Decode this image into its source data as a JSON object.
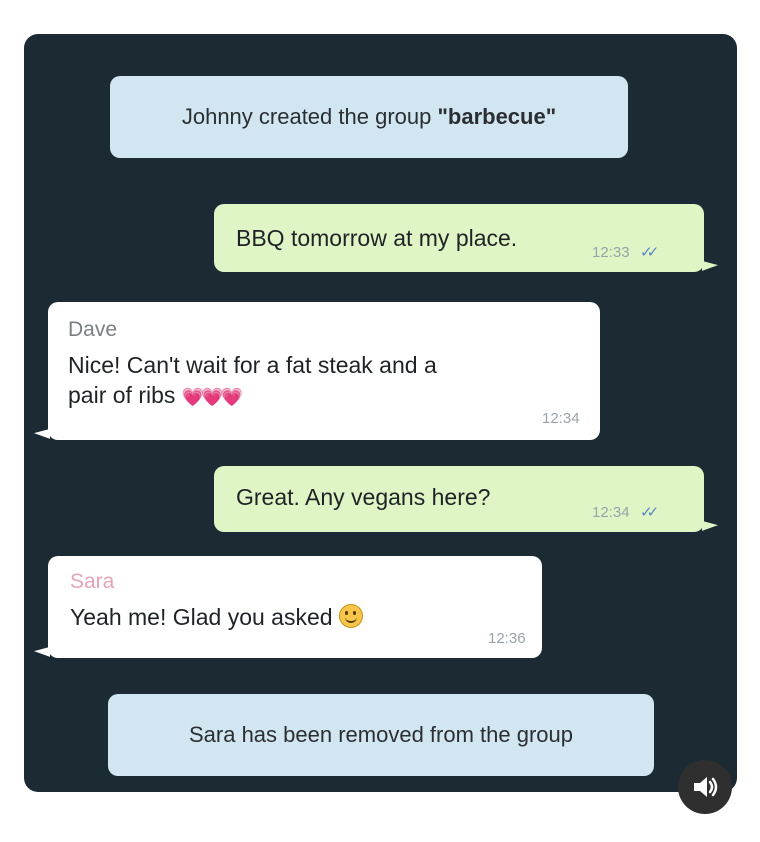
{
  "messages": {
    "system_created_prefix": "Johnny created the group ",
    "system_created_group": "\"barbecue\"",
    "m1": {
      "text": "BBQ tomorrow at my place.",
      "time": "12:33",
      "status": "✓✓"
    },
    "m2": {
      "sender": "Dave",
      "text": "Nice! Can't wait for a fat steak and a\npair of ribs",
      "emoji": "💗💗💗",
      "time": "12:34"
    },
    "m3": {
      "text": "Great. Any vegans here?",
      "time": "12:34",
      "status": "✓✓"
    },
    "m4": {
      "sender": "Sara",
      "text": "Yeah me! Glad you asked",
      "time": "12:36"
    },
    "system_removed": "Sara has been removed from the group"
  },
  "colors": {
    "chat_background": "#1c2a33",
    "outgoing_bubble": "#dff5c6",
    "incoming_bubble": "#ffffff",
    "system_bubble": "#d2e6f1",
    "sender_dave": "#7a7f83",
    "sender_sara": "#e7a3b6"
  },
  "icons": {
    "sound": "speaker-icon",
    "smiley": "smiley-emoji-icon",
    "hearts": "heart-emoji-icon",
    "read": "double-check-icon"
  }
}
